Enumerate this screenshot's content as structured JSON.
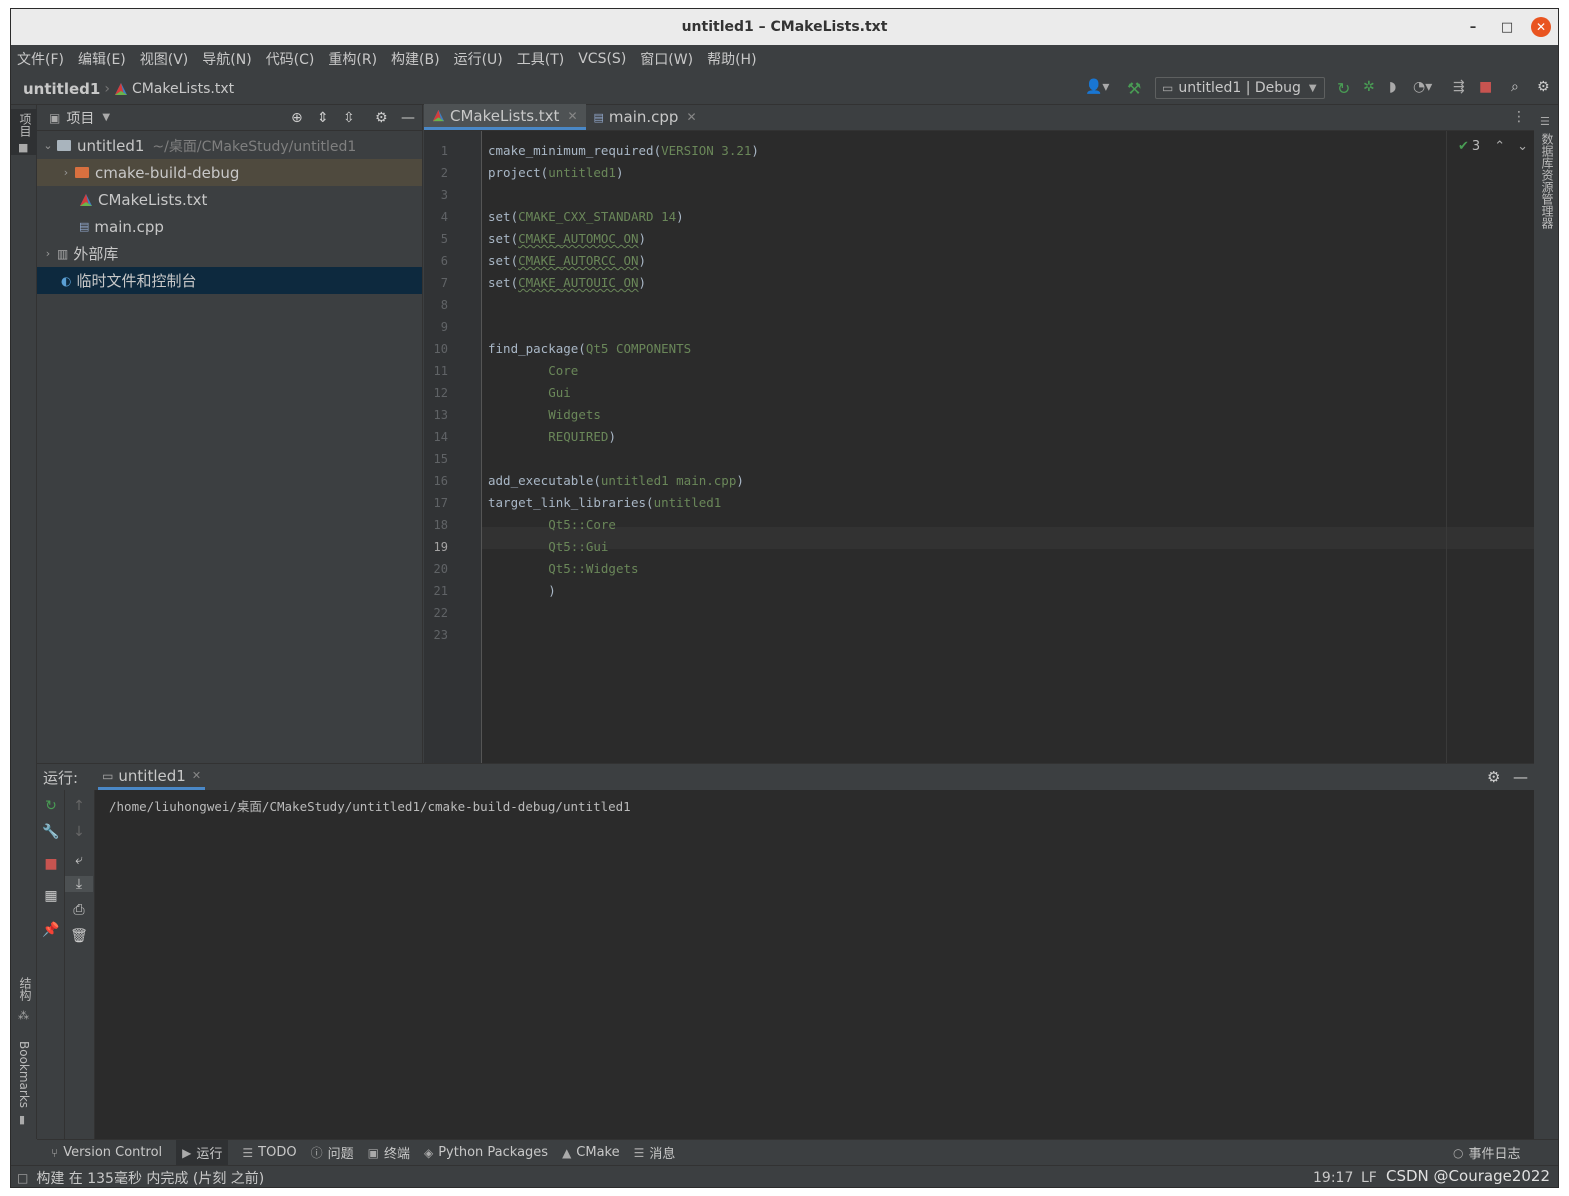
{
  "window": {
    "title": "untitled1 – CMakeLists.txt"
  },
  "menu": [
    "文件(F)",
    "编辑(E)",
    "视图(V)",
    "导航(N)",
    "代码(C)",
    "重构(R)",
    "构建(B)",
    "运行(U)",
    "工具(T)",
    "VCS(S)",
    "窗口(W)",
    "帮助(H)"
  ],
  "breadcrumb": {
    "root": "untitled1",
    "file": "CMakeLists.txt"
  },
  "run_config": "untitled1 | Debug",
  "left_strip": {
    "project": "项目",
    "structure": "结构",
    "bookmarks": "Bookmarks"
  },
  "right_strip": {
    "database": "数据库资源管理器"
  },
  "project_panel": {
    "title": "项目",
    "tree": [
      {
        "label": "untitled1",
        "hint": "~/桌面/CMakeStudy/untitled1",
        "expanded": true
      },
      {
        "label": "cmake-build-debug"
      },
      {
        "label": "CMakeLists.txt"
      },
      {
        "label": "main.cpp"
      },
      {
        "label": "外部库"
      },
      {
        "label": "临时文件和控制台"
      }
    ]
  },
  "editor": {
    "tabs": [
      {
        "label": "CMakeLists.txt",
        "active": true
      },
      {
        "label": "main.cpp",
        "active": false
      }
    ],
    "inspection_count": "3",
    "current_line": 19,
    "line_numbers": [
      "1",
      "2",
      "3",
      "4",
      "5",
      "6",
      "7",
      "8",
      "9",
      "10",
      "11",
      "12",
      "13",
      "14",
      "15",
      "16",
      "17",
      "18",
      "19",
      "20",
      "21",
      "22",
      "23"
    ],
    "lines": [
      [
        "cmake_minimum_required(",
        "VERSION 3.21",
        ")"
      ],
      [
        "project(",
        "untitled1",
        ")"
      ],
      [
        "",
        "",
        ""
      ],
      [
        "set(",
        "CMAKE_CXX_STANDARD 14",
        ")"
      ],
      [
        "set(",
        "CMAKE_AUTOMOC ON",
        ")"
      ],
      [
        "set(",
        "CMAKE_AUTORCC ON",
        ")"
      ],
      [
        "set(",
        "CMAKE_AUTOUIC ON",
        ")"
      ],
      [
        "",
        "",
        ""
      ],
      [
        "",
        "",
        ""
      ],
      [
        "find_package(",
        "Qt5 COMPONENTS",
        ""
      ],
      [
        "        ",
        "Core",
        ""
      ],
      [
        "        ",
        "Gui",
        ""
      ],
      [
        "        ",
        "Widgets",
        ""
      ],
      [
        "        ",
        "REQUIRED",
        ")"
      ],
      [
        "",
        "",
        ""
      ],
      [
        "add_executable(",
        "untitled1 main.cpp",
        ")"
      ],
      [
        "target_link_libraries(",
        "untitled1",
        ""
      ],
      [
        "        ",
        "Qt5::Core",
        ""
      ],
      [
        "        ",
        "Qt5::Gui",
        ""
      ],
      [
        "        ",
        "Qt5::Widgets",
        ""
      ],
      [
        "        ",
        "",
        ")"
      ],
      [
        "",
        "",
        ""
      ],
      [
        "",
        "",
        ""
      ]
    ]
  },
  "run_panel": {
    "label": "运行:",
    "tab": "untitled1",
    "output": "/home/liuhongwei/桌面/CMakeStudy/untitled1/cmake-build-debug/untitled1"
  },
  "bottom_tabs": [
    {
      "label": "Version Control",
      "icon": "branch-icon"
    },
    {
      "label": "运行",
      "icon": "play-icon"
    },
    {
      "label": "TODO",
      "icon": "list-icon"
    },
    {
      "label": "问题",
      "icon": "info-icon"
    },
    {
      "label": "终端",
      "icon": "terminal-icon"
    },
    {
      "label": "Python Packages",
      "icon": "layers-icon"
    },
    {
      "label": "CMake",
      "icon": "cmake-icon"
    },
    {
      "label": "消息",
      "icon": "lines-icon"
    }
  ],
  "event_log": "事件日志",
  "status": {
    "message": "构建 在 135毫秒 内完成 (片刻 之前)",
    "position": "19:17",
    "line_sep": "LF",
    "watermark": "CSDN @Courage2022"
  },
  "colors": {
    "accent": "#4a88c7",
    "string_green": "#6a8759",
    "close_orange": "#e95420",
    "run_green": "#499c54",
    "stop_red": "#c75450"
  }
}
